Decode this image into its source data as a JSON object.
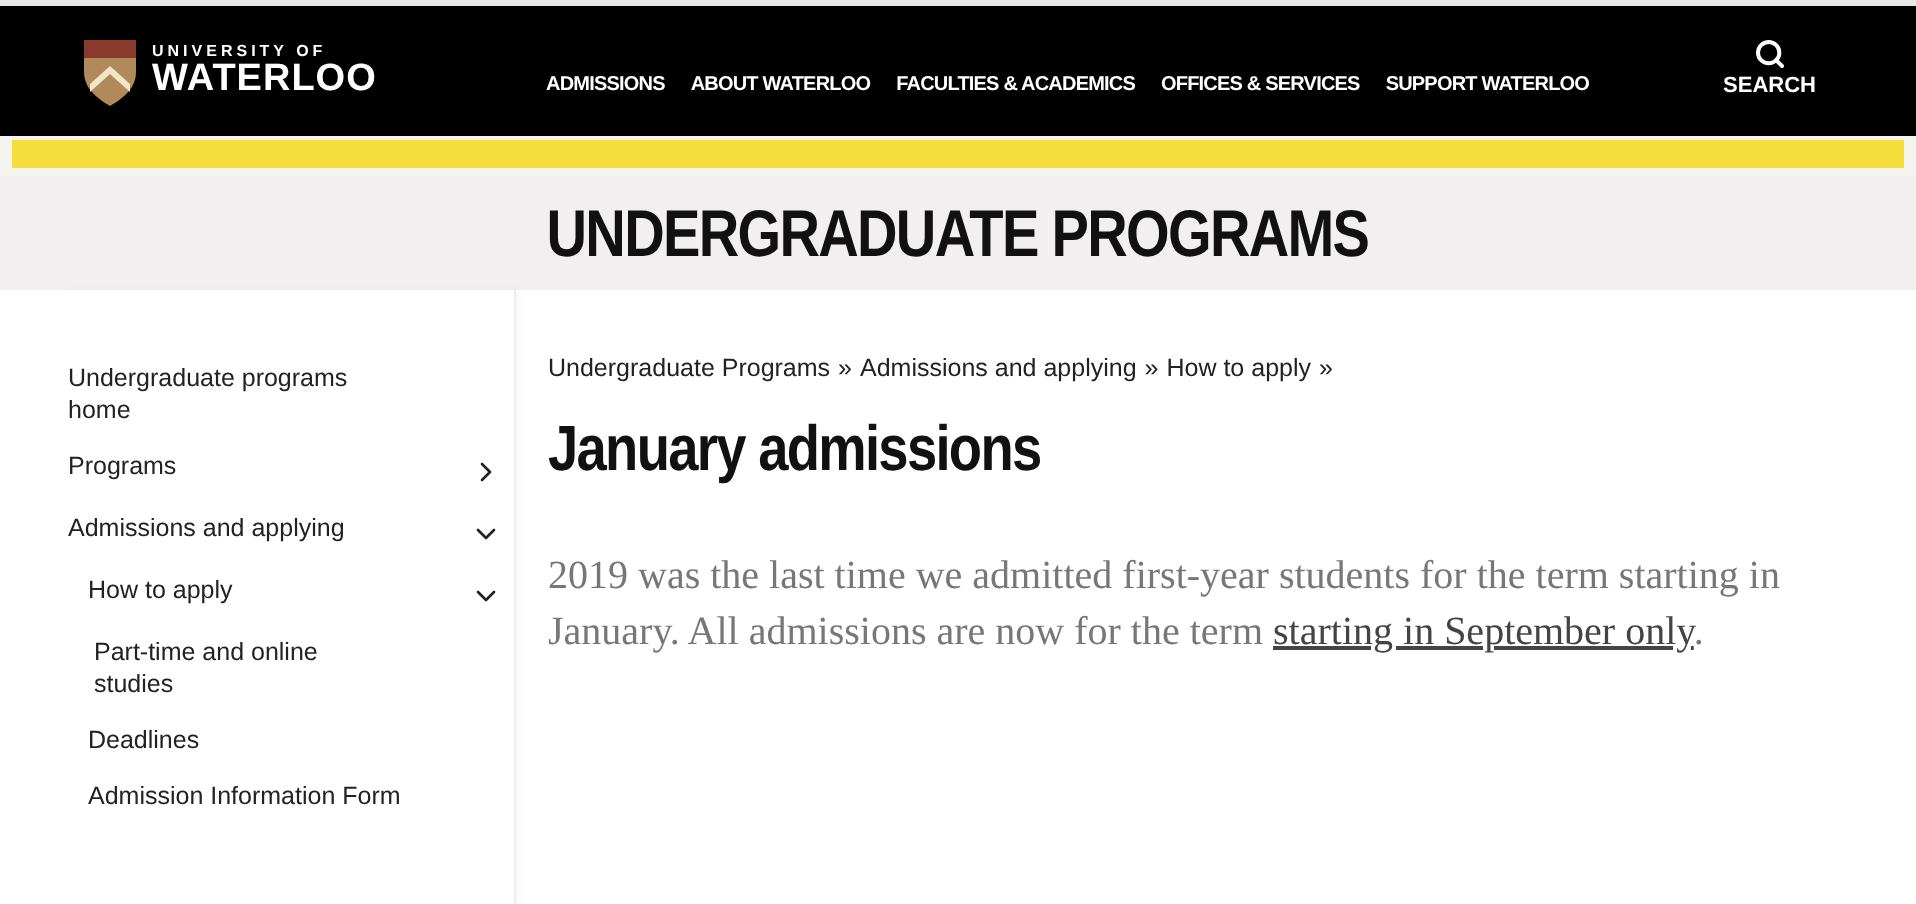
{
  "header": {
    "logo_top": "UNIVERSITY OF",
    "logo_bottom": "WATERLOO",
    "nav": [
      "ADMISSIONS",
      "ABOUT WATERLOO",
      "FACULTIES & ACADEMICS",
      "OFFICES & SERVICES",
      "SUPPORT WATERLOO"
    ],
    "search": "SEARCH"
  },
  "banner": {
    "title": "UNDERGRADUATE PROGRAMS"
  },
  "sidebar": {
    "items": [
      {
        "label": "Undergraduate programs home"
      },
      {
        "label": "Programs",
        "expanded": false
      },
      {
        "label": "Admissions and applying",
        "expanded": true,
        "children": [
          {
            "label": "How to apply",
            "expanded": true,
            "children": [
              {
                "label": "Part-time and online studies"
              }
            ]
          },
          {
            "label": "Deadlines"
          },
          {
            "label": "Admission Information Form"
          }
        ]
      }
    ]
  },
  "breadcrumb": [
    "Undergraduate Programs",
    "Admissions and applying",
    "How to apply"
  ],
  "breadcrumb_separator": "»",
  "page_title": "January admissions",
  "paragraph": {
    "text": "2019 was the last time we admitted first-year students for the term starting in January. All admissions are now for the term ",
    "link": "starting in September only",
    "after": "."
  }
}
